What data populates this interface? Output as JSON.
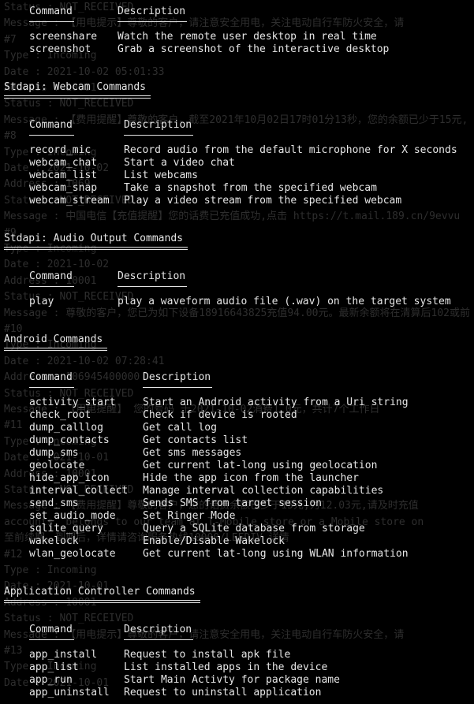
{
  "background_text": [
    "Status : NOT_RECEIVED",
    "Message : 【用电提示】尊敬的客户，请注意安全用电，关注电动自行车防火安全，请",
    "#7",
    "Type : Incoming",
    "Date : 2021-10-02 05:01:33",
    "Address : 10001",
    "Status : NOT_RECEIVED",
    "Message : 【费用提醒】尊敬的客户，截至2021年10月02日17时01分13秒，您的余额已少于15元,",
    "#8",
    "Type : Incoming",
    "Date : 2021-10-02",
    "Address : 1069",
    "Status : NOT_RECEIVED",
    "Message : 中国电信【充值提醒】您的话费已充值成功,点击 https://t.mail.189.cn/9evvu",
    "#9",
    "Type : Incoming",
    "Date : 2021-10-02",
    "Address : 10001",
    "Status : NOT_RECEIVED",
    "Message : 尊敬的客户，您已为如下设备18916643825充值94.00元。最新余额将在清算后102或前",
    "#10",
    "Type : Incoming",
    "Date : 2021-10-02 07:28:41",
    "Address : 106945400000",
    "Status : NOT_RECEIVED",
    "Message : 【用电提醒】 您的号码 于2021-10-02消费1.0元，共计7个工作日",
    "#11",
    "Type : Incoming",
    "Date : 2021-10-01",
    "Address : 10001",
    "Status : NOT_RECEIVED",
    "Message : 【费用提醒】尊敬的客户，您的话费余额已少于15元,为12.03元,请及时充值",
    "accounts. belongs to our team at T-Mobile store or a Mobile store on",
    "至前续期，到期后，详情请咨询服务热线10000/LEEDIV 详情",
    "#12",
    "Type : Incoming",
    "Date : 2021-10-01",
    "Address : 10001",
    "Status : NOT_RECEIVED",
    "Message : 【用电提示】尊敬的客户，请注意安全用电，关注电动自行车防火安全，请",
    "#13",
    "Type : Incoming",
    "Date : 2021-10-01"
  ],
  "column_headers": {
    "command": "Command",
    "description": "Description"
  },
  "sections": [
    {
      "title": "",
      "rows": [
        {
          "cmd": "screenshare",
          "desc": "Watch the remote user desktop in real time"
        },
        {
          "cmd": "screenshot",
          "desc": "Grab a screenshot of the interactive desktop"
        }
      ]
    },
    {
      "title": "Stdapi: Webcam Commands",
      "rows": [
        {
          "cmd": "record_mic",
          "desc": "Record audio from the default microphone for X seconds"
        },
        {
          "cmd": "webcam_chat",
          "desc": "Start a video chat"
        },
        {
          "cmd": "webcam_list",
          "desc": "List webcams"
        },
        {
          "cmd": "webcam_snap",
          "desc": "Take a snapshot from the specified webcam"
        },
        {
          "cmd": "webcam_stream",
          "desc": "Play a video stream from the specified webcam"
        }
      ]
    },
    {
      "title": "Stdapi: Audio Output Commands",
      "rows": [
        {
          "cmd": "play",
          "desc": "play a waveform audio file (.wav) on the target system"
        }
      ]
    },
    {
      "title": "Android Commands",
      "rows": [
        {
          "cmd": "activity_start",
          "desc": "Start an Android activity from a Uri string"
        },
        {
          "cmd": "check_root",
          "desc": "Check if device is rooted"
        },
        {
          "cmd": "dump_calllog",
          "desc": "Get call log"
        },
        {
          "cmd": "dump_contacts",
          "desc": "Get contacts list"
        },
        {
          "cmd": "dump_sms",
          "desc": "Get sms messages"
        },
        {
          "cmd": "geolocate",
          "desc": "Get current lat-long using geolocation"
        },
        {
          "cmd": "hide_app_icon",
          "desc": "Hide the app icon from the launcher"
        },
        {
          "cmd": "interval_collect",
          "desc": "Manage interval collection capabilities"
        },
        {
          "cmd": "send_sms",
          "desc": "Sends SMS from target session"
        },
        {
          "cmd": "set_audio_mode",
          "desc": "Set Ringer Mode"
        },
        {
          "cmd": "sqlite_query",
          "desc": "Query a SQLite database from storage"
        },
        {
          "cmd": "wakelock",
          "desc": "Enable/Disable Wakelock"
        },
        {
          "cmd": "wlan_geolocate",
          "desc": "Get current lat-long using WLAN information"
        }
      ]
    },
    {
      "title": "Application Controller Commands",
      "rows": [
        {
          "cmd": "app_install",
          "desc": "Request to install apk file"
        },
        {
          "cmd": "app_list",
          "desc": "List installed apps in the device"
        },
        {
          "cmd": "app_run",
          "desc": "Start Main Activty for package name"
        },
        {
          "cmd": "app_uninstall",
          "desc": "Request to uninstall application"
        }
      ]
    }
  ],
  "colors": {
    "background": "#000000",
    "foreground": "#e6e6e6",
    "ghost_text": "#2e2e2e"
  }
}
